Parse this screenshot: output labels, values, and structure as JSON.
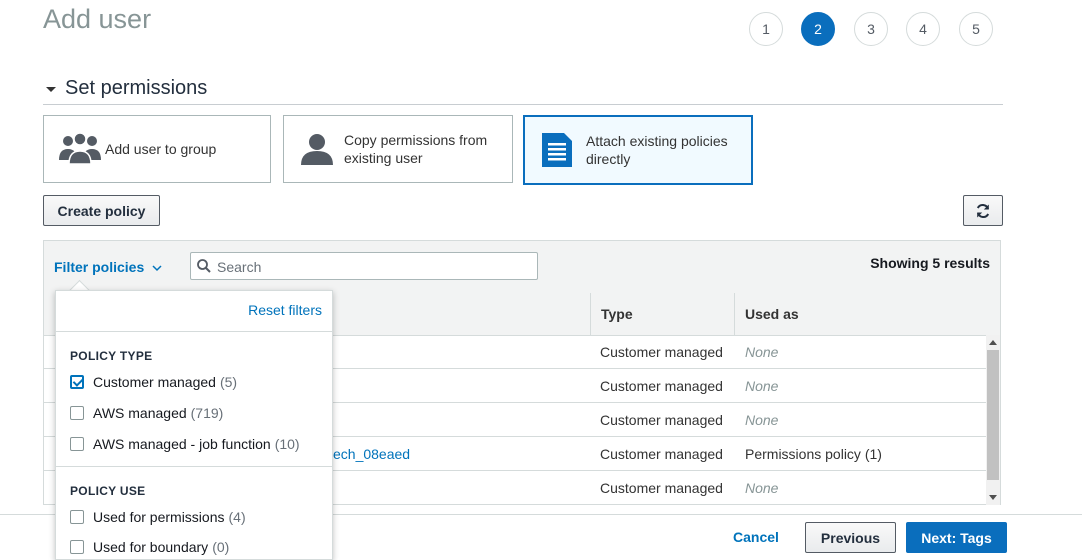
{
  "page": {
    "title": "Add user"
  },
  "steps": [
    "1",
    "2",
    "3",
    "4",
    "5"
  ],
  "active_step": 2,
  "section": {
    "title": "Set permissions"
  },
  "options": [
    {
      "label": "Add user to group",
      "icon": "group-icon",
      "selected": false
    },
    {
      "label": "Copy permissions from existing user",
      "icon": "user-icon",
      "selected": false
    },
    {
      "label": "Attach existing policies directly",
      "icon": "document-icon",
      "selected": true
    }
  ],
  "toolbar": {
    "create_policy": "Create policy",
    "refresh_icon": "refresh-icon"
  },
  "filter": {
    "label": "Filter policies",
    "search_placeholder": "Search",
    "showing": "Showing 5 results"
  },
  "table": {
    "headers": [
      "Type",
      "Used as"
    ],
    "rows": [
      {
        "name": "",
        "type": "Customer managed",
        "used_as": "None"
      },
      {
        "name": "",
        "type": "Customer managed",
        "used_as": "None"
      },
      {
        "name": "",
        "type": "Customer managed",
        "used_as": "None"
      },
      {
        "name": "ech_08eaed",
        "type": "Customer managed",
        "used_as": "Permissions policy (1)"
      },
      {
        "name": "",
        "type": "Customer managed",
        "used_as": "None"
      }
    ]
  },
  "dropdown": {
    "reset": "Reset filters",
    "policy_type_title": "POLICY TYPE",
    "policy_type": [
      {
        "label": "Customer managed",
        "count": "(5)",
        "checked": true
      },
      {
        "label": "AWS managed",
        "count": "(719)",
        "checked": false
      },
      {
        "label": "AWS managed - job function",
        "count": "(10)",
        "checked": false
      }
    ],
    "policy_use_title": "POLICY USE",
    "policy_use": [
      {
        "label": "Used for permissions",
        "count": "(4)",
        "checked": false
      },
      {
        "label": "Used for boundary",
        "count": "(0)",
        "checked": false
      }
    ]
  },
  "footer": {
    "cancel": "Cancel",
    "previous": "Previous",
    "next": "Next: Tags"
  },
  "colors": {
    "primary": "#0a6ebd",
    "link": "#0073bb"
  }
}
